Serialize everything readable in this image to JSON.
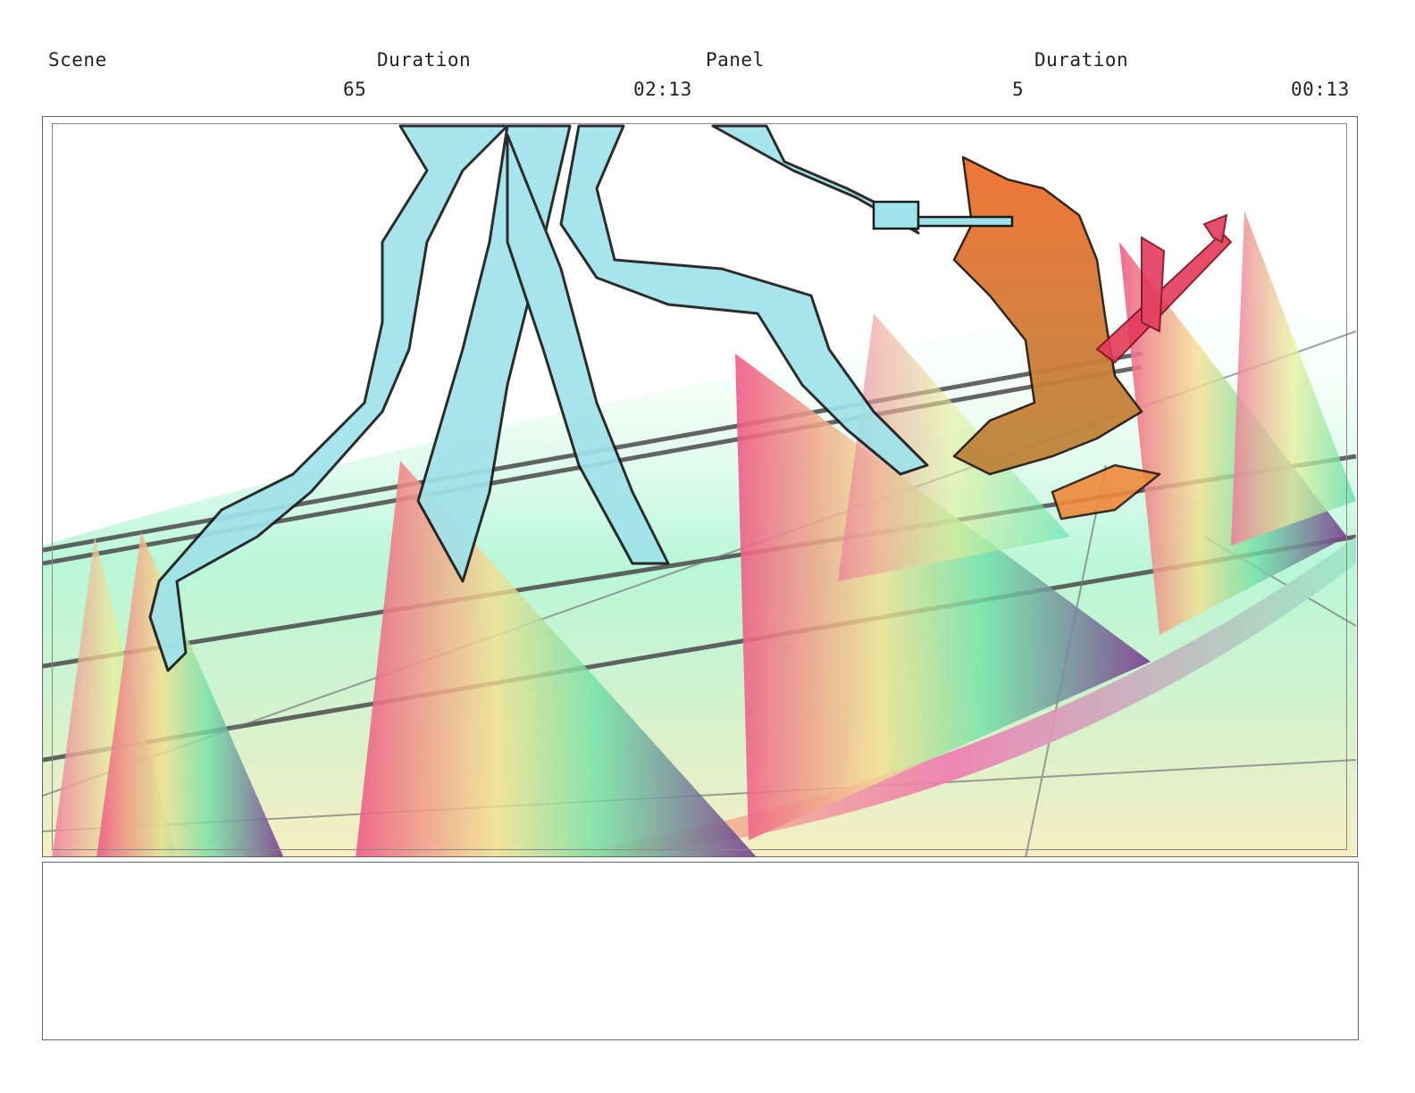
{
  "header": {
    "scene_label": "Scene",
    "scene_duration_label": "Duration",
    "panel_label": "Panel",
    "panel_duration_label": "Duration",
    "scene_number": "65",
    "scene_duration": "02:13",
    "panel_number": "5",
    "panel_duration": "00:13"
  },
  "panel_image": {
    "description_icon": "storyboard-sketch-icon",
    "colors": {
      "creature": "#9fe3ea",
      "character": "#ee7a3c",
      "weapon": "#e33a5a",
      "lines": "#1b1b1b"
    }
  },
  "notes": {
    "text": ""
  }
}
